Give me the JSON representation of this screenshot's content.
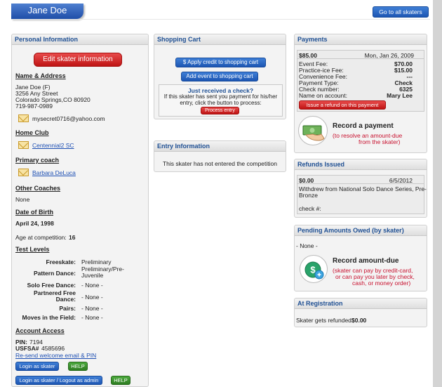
{
  "header": {
    "skater_name": "Jane Doe",
    "go_all_label": "Go to all skaters"
  },
  "personal": {
    "title": "Personal Information",
    "edit_label": "Edit skater information",
    "name_address_title": "Name & Address",
    "address_lines": [
      "Jane Doe (F)",
      "3256 Any Street",
      "Colorado Springs,CO 80920",
      "719-987-0989"
    ],
    "email": "mysecret0716@yahoo.com",
    "home_club_title": "Home Club",
    "home_club": "Centennial2 SC",
    "primary_coach_title": "Primary coach",
    "primary_coach": "Barbara DeLuca",
    "other_coaches_title": "Other Coaches",
    "other_coaches": "None",
    "dob_title": "Date of Birth",
    "dob": "April 24, 1998",
    "age_label": "Age at competition:",
    "age_value": "16",
    "test_levels_title": "Test Levels",
    "tests": [
      {
        "label": "Freeskate:",
        "value": "Preliminary"
      },
      {
        "label": "Pattern Dance:",
        "value": "Preliminary/Pre-Juvenile"
      },
      {
        "label": "Solo Free Dance:",
        "value": "- None -"
      },
      {
        "label": "Partnered Free Dance:",
        "value": "- None -"
      },
      {
        "label": "Pairs:",
        "value": "- None -"
      },
      {
        "label": "Moves in the Field:",
        "value": "- None -"
      }
    ],
    "account_title": "Account Access",
    "pin_label": "PIN:",
    "pin_value": "7194",
    "usfsa_label": "USFSA#",
    "usfsa_value": "4585696",
    "resend_label": "Re-send welcome email & PIN",
    "login_label": "Login as skater",
    "help_label": "HELP",
    "login_admin_label": "Login as skater / Logout as admin",
    "help2_label": "HELP"
  },
  "cart": {
    "title": "Shopping Cart",
    "apply_credit_label": "$  Apply credit to shopping cart",
    "add_event_label": "Add event to shopping cart",
    "check_title": "Just received a check?",
    "check_text_1": "If this skater has sent you payment for his/her",
    "check_text_2": "entry, click the button to process:",
    "process_label": "Process entry"
  },
  "entry": {
    "title": "Entry Information",
    "text": "This skater has not entered the competition"
  },
  "payments": {
    "title": "Payments",
    "amount": "$85.00",
    "date": "Mon, Jan 26, 2009",
    "rows": [
      {
        "label": "Event Fee:",
        "value": "$70.00"
      },
      {
        "label": "Practice-ice Fee:",
        "value": "$15.00"
      },
      {
        "label": "Convenience Fee:",
        "value": "---"
      },
      {
        "label": "Payment Type:",
        "value": "Check"
      },
      {
        "label": "Check number:",
        "value": "6325"
      },
      {
        "label": "Name on account:",
        "value": "Mary Lee"
      }
    ],
    "refund_label": "Issue a refund on this payment",
    "record_title": "Record a payment",
    "record_sub_1": "(to resolve an amount-due",
    "record_sub_2": "from the skater)"
  },
  "refunds": {
    "title": "Refunds Issued",
    "amount": "$0.00",
    "date": "6/5/2012",
    "desc_1": "Withdrew from National Solo Dance Series, Pre-",
    "desc_2": "Bronze",
    "check_label": "check #:"
  },
  "pending": {
    "title": "Pending Amounts Owed (by skater)",
    "none": "- None -",
    "record_title": "Record amount-due",
    "sub_1": "(skater can pay by credit-card,",
    "sub_2": "or can pay you later by check,",
    "sub_3": "cash, or money order)"
  },
  "registration": {
    "title": "At Registration",
    "text": "Skater gets refunded:",
    "value": "$0.00"
  },
  "colors": {
    "accent_blue": "#1d56b3",
    "header_text": "#1e4f93",
    "danger_red": "#c8102e",
    "help_green": "#2d7c20"
  }
}
